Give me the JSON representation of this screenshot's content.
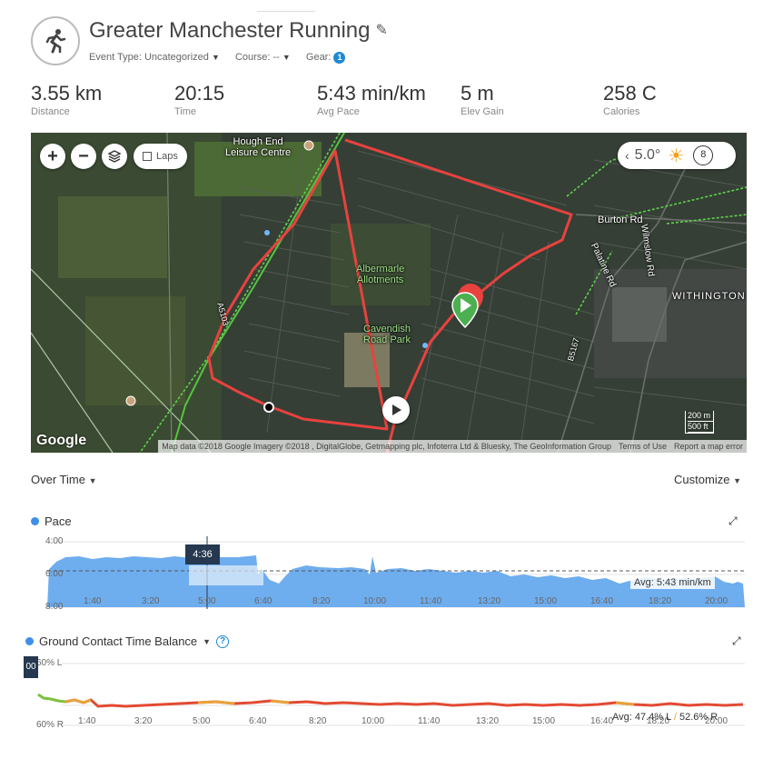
{
  "header": {
    "title": "Greater Manchester Running",
    "activity_icon": "running-person-icon",
    "event_type": "Event Type: Uncategorized",
    "course": "Course: --",
    "gear_label": "Gear:",
    "gear_count": "1"
  },
  "stats": [
    {
      "value": "3.55 km",
      "label": "Distance"
    },
    {
      "value": "20:15",
      "label": "Time"
    },
    {
      "value": "5:43 min/km",
      "label": "Avg Pace"
    },
    {
      "value": "5 m",
      "label": "Elev Gain"
    },
    {
      "value": "258 C",
      "label": "Calories"
    }
  ],
  "map": {
    "laps_label": "Laps",
    "temperature": "5.0°",
    "wind": "8",
    "labels": {
      "hough_end": "Hough End\nLeisure Centre",
      "albermarle": "Albermarle\nAllotments",
      "cavendish": "Cavendish\nRoad Park",
      "burton": "Burton Rd",
      "withington": "WITHINGTON",
      "palatine": "Palatine Rd",
      "wilmslow": "Wilmslow Rd",
      "b5167": "B5167",
      "a5103": "A5103"
    },
    "google": "Google",
    "attribution": "Map data ©2018 Google Imagery ©2018 , DigitalGlobe, Getmapping plc, Infoterra Ltd & Bluesky, The GeoInformation Group",
    "terms": "Terms of Use",
    "report": "Report a map error",
    "scale_m": "200 m",
    "scale_ft": "500 ft",
    "colors": {
      "route": "#e8423f",
      "start": "#4caf50"
    }
  },
  "controls": {
    "over_time": "Over Time",
    "customize": "Customize"
  },
  "pace_chart": {
    "title": "Pace",
    "y_labels": [
      "4:00",
      "6:00",
      "8:00"
    ],
    "x_ticks": [
      "1:40",
      "3:20",
      "5:00",
      "6:40",
      "8:20",
      "10:00",
      "11:40",
      "13:20",
      "15:00",
      "16:40",
      "18:20",
      "20:00"
    ],
    "tooltip": "4:36",
    "avg": "Avg: 5:43 min/km",
    "color": "#5ea4ec"
  },
  "gct_chart": {
    "title": "Ground Contact Time Balance",
    "y_labels": [
      "60% L",
      "60% R"
    ],
    "x_ticks": [
      "1:40",
      "3:20",
      "5:00",
      "6:40",
      "8:20",
      "10:00",
      "11:40",
      "13:20",
      "15:00",
      "16:40",
      "18:20",
      "20:00"
    ],
    "tooltip": "00",
    "avg_prefix": "Avg: 47.4% L",
    "avg_sep": "/",
    "avg_suffix": "52.6% R",
    "colors": {
      "high": "#e34a33",
      "mid": "#e8a33c",
      "low": "#7cc13d"
    }
  }
}
